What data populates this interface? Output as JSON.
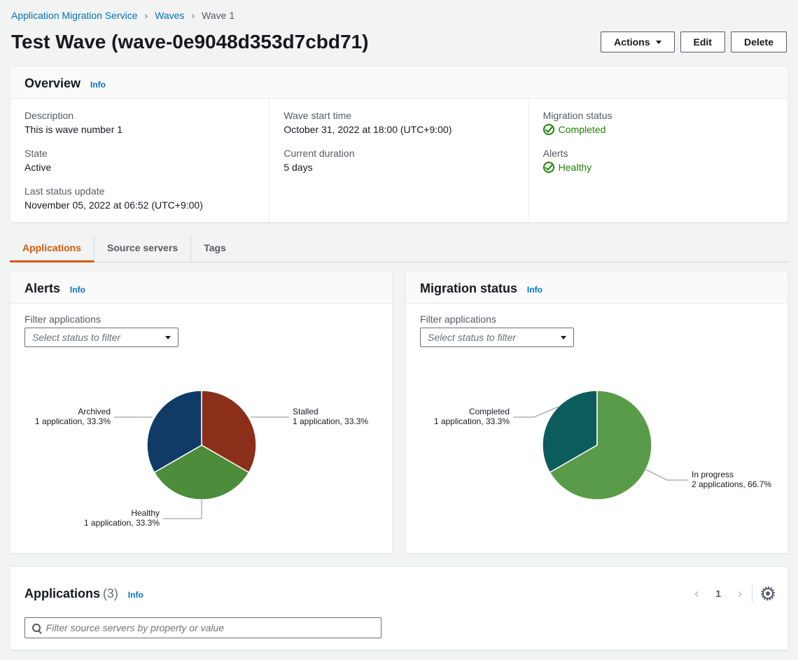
{
  "breadcrumb": {
    "root": "Application Migration Service",
    "mid": "Waves",
    "current": "Wave 1"
  },
  "header": {
    "title": "Test Wave (wave-0e9048d353d7cbd71)",
    "actions": "Actions",
    "edit": "Edit",
    "delete": "Delete"
  },
  "overview": {
    "title": "Overview",
    "info": "Info",
    "description_label": "Description",
    "description_value": "This is wave number 1",
    "state_label": "State",
    "state_value": "Active",
    "last_status_label": "Last status update",
    "last_status_value": "November 05, 2022 at 06:52 (UTC+9:00)",
    "start_label": "Wave start time",
    "start_value": "October 31, 2022 at 18:00 (UTC+9:00)",
    "duration_label": "Current duration",
    "duration_value": "5 days",
    "migration_status_label": "Migration status",
    "migration_status_value": "Completed",
    "alerts_label": "Alerts",
    "alerts_value": "Healthy"
  },
  "tabs": {
    "applications": "Applications",
    "source_servers": "Source servers",
    "tags": "Tags"
  },
  "alerts_panel": {
    "title": "Alerts",
    "info": "Info",
    "filter_label": "Filter applications",
    "filter_placeholder": "Select status to filter"
  },
  "migration_panel": {
    "title": "Migration status",
    "info": "Info",
    "filter_label": "Filter applications",
    "filter_placeholder": "Select status to filter"
  },
  "apps_panel": {
    "title": "Applications",
    "count": "(3)",
    "info": "Info",
    "page": "1",
    "search_placeholder": "Filter source servers by property or value"
  },
  "chart_data": [
    {
      "type": "pie",
      "title": "Alerts",
      "series": [
        {
          "name": "Stalled",
          "detail": "1 application, 33.3%",
          "value": 33.3,
          "color": "#7c2d12"
        },
        {
          "name": "Healthy",
          "detail": "1 application, 33.3%",
          "value": 33.3,
          "color": "#3f8624"
        },
        {
          "name": "Archived",
          "detail": "1 application, 33.3%",
          "value": 33.3,
          "color": "#0a3a5e"
        }
      ]
    },
    {
      "type": "pie",
      "title": "Migration status",
      "series": [
        {
          "name": "Completed",
          "detail": "1 application, 33.3%",
          "value": 33.3,
          "color": "#0d5c5c"
        },
        {
          "name": "In progress",
          "detail": "2 applications, 66.7%",
          "value": 66.7,
          "color": "#4f8f3b"
        }
      ]
    }
  ]
}
